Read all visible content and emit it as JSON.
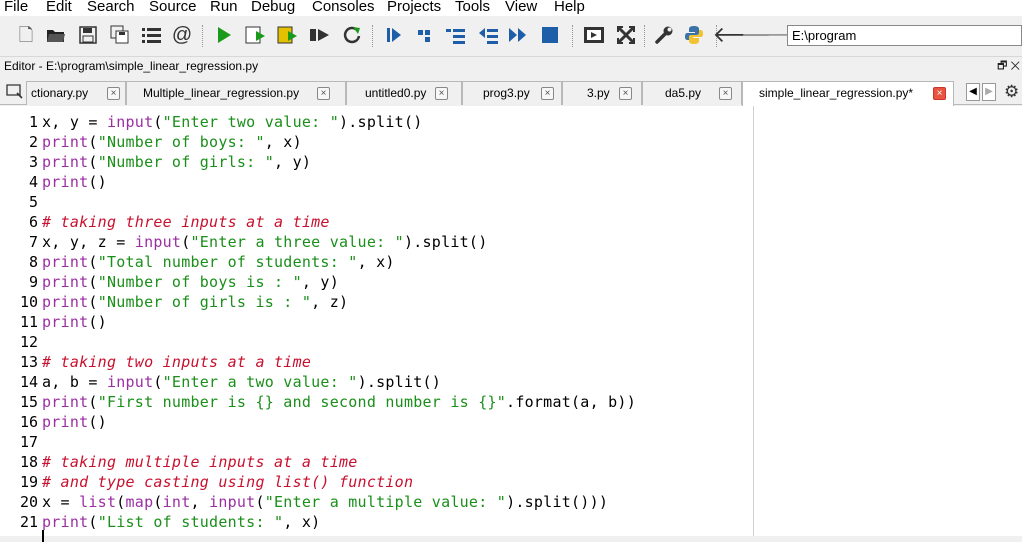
{
  "menu": [
    "File",
    "Edit",
    "Search",
    "Source",
    "Run",
    "Debug",
    "Consoles",
    "Projects",
    "Tools",
    "View",
    "Help"
  ],
  "toolbar": {
    "path": "E:\\program"
  },
  "editor_title": "Editor - E:\\program\\simple_linear_regression.py",
  "float_icon": "restore-icon",
  "tabs": [
    {
      "label": "ctionary.py"
    },
    {
      "label": "Multiple_linear_regression.py"
    },
    {
      "label": "untitled0.py"
    },
    {
      "label": "prog3.py"
    },
    {
      "label": "3.py"
    },
    {
      "label": "da5.py"
    },
    {
      "label": "simple_linear_regression.py*"
    }
  ],
  "code": [
    {
      "n": "1",
      "t": "x, y = input(\"Enter two value: \").split()"
    },
    {
      "n": "2",
      "t": "print(\"Number of boys: \", x)"
    },
    {
      "n": "3",
      "t": "print(\"Number of girls: \", y)"
    },
    {
      "n": "4",
      "t": "print()"
    },
    {
      "n": "5",
      "t": ""
    },
    {
      "n": "6",
      "t": "# taking three inputs at a time"
    },
    {
      "n": "7",
      "t": "x, y, z = input(\"Enter a three value: \").split()"
    },
    {
      "n": "8",
      "t": "print(\"Total number of students: \", x)"
    },
    {
      "n": "9",
      "t": "print(\"Number of boys is : \", y)"
    },
    {
      "n": "10",
      "t": "print(\"Number of girls is : \", z)"
    },
    {
      "n": "11",
      "t": "print()"
    },
    {
      "n": "12",
      "t": ""
    },
    {
      "n": "13",
      "t": "# taking two inputs at a time"
    },
    {
      "n": "14",
      "t": "a, b = input(\"Enter a two value: \").split()"
    },
    {
      "n": "15",
      "t": "print(\"First number is {} and second number is {}\".format(a, b))"
    },
    {
      "n": "16",
      "t": "print()"
    },
    {
      "n": "17",
      "t": ""
    },
    {
      "n": "18",
      "t": "# taking multiple inputs at a time"
    },
    {
      "n": "19",
      "t": "# and type casting using list() function"
    },
    {
      "n": "20",
      "t": "x = list(map(int, input(\"Enter a multiple value: \").split()))"
    },
    {
      "n": "21",
      "t": "print(\"List of students: \", x)"
    }
  ]
}
